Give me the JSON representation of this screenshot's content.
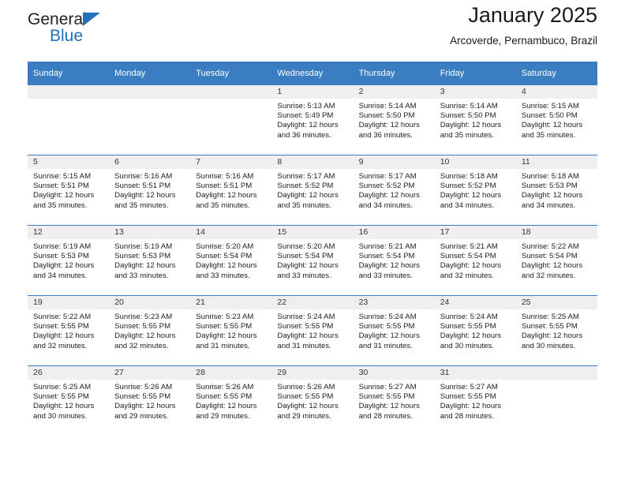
{
  "brand": {
    "name_part1": "General",
    "name_part2": "Blue",
    "accent_color": "#1f71bb",
    "logo_icon": "triangle-icon"
  },
  "header": {
    "title": "January 2025",
    "subtitle": "Arcoverde, Pernambuco, Brazil"
  },
  "theme": {
    "header_blue": "#3a7dc0",
    "band_gray": "#efefef"
  },
  "calendar": {
    "weekday_headers": [
      "Sunday",
      "Monday",
      "Tuesday",
      "Wednesday",
      "Thursday",
      "Friday",
      "Saturday"
    ],
    "weeks": [
      [
        {
          "day": "",
          "lines": []
        },
        {
          "day": "",
          "lines": []
        },
        {
          "day": "",
          "lines": []
        },
        {
          "day": "1",
          "lines": [
            "Sunrise: 5:13 AM",
            "Sunset: 5:49 PM",
            "Daylight: 12 hours",
            "and 36 minutes."
          ]
        },
        {
          "day": "2",
          "lines": [
            "Sunrise: 5:14 AM",
            "Sunset: 5:50 PM",
            "Daylight: 12 hours",
            "and 36 minutes."
          ]
        },
        {
          "day": "3",
          "lines": [
            "Sunrise: 5:14 AM",
            "Sunset: 5:50 PM",
            "Daylight: 12 hours",
            "and 35 minutes."
          ]
        },
        {
          "day": "4",
          "lines": [
            "Sunrise: 5:15 AM",
            "Sunset: 5:50 PM",
            "Daylight: 12 hours",
            "and 35 minutes."
          ]
        }
      ],
      [
        {
          "day": "5",
          "lines": [
            "Sunrise: 5:15 AM",
            "Sunset: 5:51 PM",
            "Daylight: 12 hours",
            "and 35 minutes."
          ]
        },
        {
          "day": "6",
          "lines": [
            "Sunrise: 5:16 AM",
            "Sunset: 5:51 PM",
            "Daylight: 12 hours",
            "and 35 minutes."
          ]
        },
        {
          "day": "7",
          "lines": [
            "Sunrise: 5:16 AM",
            "Sunset: 5:51 PM",
            "Daylight: 12 hours",
            "and 35 minutes."
          ]
        },
        {
          "day": "8",
          "lines": [
            "Sunrise: 5:17 AM",
            "Sunset: 5:52 PM",
            "Daylight: 12 hours",
            "and 35 minutes."
          ]
        },
        {
          "day": "9",
          "lines": [
            "Sunrise: 5:17 AM",
            "Sunset: 5:52 PM",
            "Daylight: 12 hours",
            "and 34 minutes."
          ]
        },
        {
          "day": "10",
          "lines": [
            "Sunrise: 5:18 AM",
            "Sunset: 5:52 PM",
            "Daylight: 12 hours",
            "and 34 minutes."
          ]
        },
        {
          "day": "11",
          "lines": [
            "Sunrise: 5:18 AM",
            "Sunset: 5:53 PM",
            "Daylight: 12 hours",
            "and 34 minutes."
          ]
        }
      ],
      [
        {
          "day": "12",
          "lines": [
            "Sunrise: 5:19 AM",
            "Sunset: 5:53 PM",
            "Daylight: 12 hours",
            "and 34 minutes."
          ]
        },
        {
          "day": "13",
          "lines": [
            "Sunrise: 5:19 AM",
            "Sunset: 5:53 PM",
            "Daylight: 12 hours",
            "and 33 minutes."
          ]
        },
        {
          "day": "14",
          "lines": [
            "Sunrise: 5:20 AM",
            "Sunset: 5:54 PM",
            "Daylight: 12 hours",
            "and 33 minutes."
          ]
        },
        {
          "day": "15",
          "lines": [
            "Sunrise: 5:20 AM",
            "Sunset: 5:54 PM",
            "Daylight: 12 hours",
            "and 33 minutes."
          ]
        },
        {
          "day": "16",
          "lines": [
            "Sunrise: 5:21 AM",
            "Sunset: 5:54 PM",
            "Daylight: 12 hours",
            "and 33 minutes."
          ]
        },
        {
          "day": "17",
          "lines": [
            "Sunrise: 5:21 AM",
            "Sunset: 5:54 PM",
            "Daylight: 12 hours",
            "and 32 minutes."
          ]
        },
        {
          "day": "18",
          "lines": [
            "Sunrise: 5:22 AM",
            "Sunset: 5:54 PM",
            "Daylight: 12 hours",
            "and 32 minutes."
          ]
        }
      ],
      [
        {
          "day": "19",
          "lines": [
            "Sunrise: 5:22 AM",
            "Sunset: 5:55 PM",
            "Daylight: 12 hours",
            "and 32 minutes."
          ]
        },
        {
          "day": "20",
          "lines": [
            "Sunrise: 5:23 AM",
            "Sunset: 5:55 PM",
            "Daylight: 12 hours",
            "and 32 minutes."
          ]
        },
        {
          "day": "21",
          "lines": [
            "Sunrise: 5:23 AM",
            "Sunset: 5:55 PM",
            "Daylight: 12 hours",
            "and 31 minutes."
          ]
        },
        {
          "day": "22",
          "lines": [
            "Sunrise: 5:24 AM",
            "Sunset: 5:55 PM",
            "Daylight: 12 hours",
            "and 31 minutes."
          ]
        },
        {
          "day": "23",
          "lines": [
            "Sunrise: 5:24 AM",
            "Sunset: 5:55 PM",
            "Daylight: 12 hours",
            "and 31 minutes."
          ]
        },
        {
          "day": "24",
          "lines": [
            "Sunrise: 5:24 AM",
            "Sunset: 5:55 PM",
            "Daylight: 12 hours",
            "and 30 minutes."
          ]
        },
        {
          "day": "25",
          "lines": [
            "Sunrise: 5:25 AM",
            "Sunset: 5:55 PM",
            "Daylight: 12 hours",
            "and 30 minutes."
          ]
        }
      ],
      [
        {
          "day": "26",
          "lines": [
            "Sunrise: 5:25 AM",
            "Sunset: 5:55 PM",
            "Daylight: 12 hours",
            "and 30 minutes."
          ]
        },
        {
          "day": "27",
          "lines": [
            "Sunrise: 5:26 AM",
            "Sunset: 5:55 PM",
            "Daylight: 12 hours",
            "and 29 minutes."
          ]
        },
        {
          "day": "28",
          "lines": [
            "Sunrise: 5:26 AM",
            "Sunset: 5:55 PM",
            "Daylight: 12 hours",
            "and 29 minutes."
          ]
        },
        {
          "day": "29",
          "lines": [
            "Sunrise: 5:26 AM",
            "Sunset: 5:55 PM",
            "Daylight: 12 hours",
            "and 29 minutes."
          ]
        },
        {
          "day": "30",
          "lines": [
            "Sunrise: 5:27 AM",
            "Sunset: 5:55 PM",
            "Daylight: 12 hours",
            "and 28 minutes."
          ]
        },
        {
          "day": "31",
          "lines": [
            "Sunrise: 5:27 AM",
            "Sunset: 5:55 PM",
            "Daylight: 12 hours",
            "and 28 minutes."
          ]
        },
        {
          "day": "",
          "lines": []
        }
      ]
    ]
  }
}
